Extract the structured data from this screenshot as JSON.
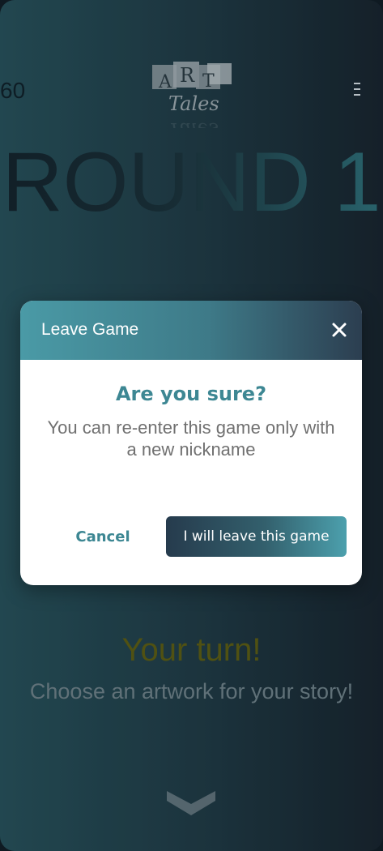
{
  "header": {
    "timer": "60",
    "logo_alt": "ART Tales",
    "logo_letters": [
      "A",
      "R",
      "T"
    ],
    "logo_word": "Tales",
    "menu_icon": "kebab-menu-icon"
  },
  "round": {
    "title": "ROUND 1"
  },
  "prompt": {
    "headline": "Your turn!",
    "subtitle": "Choose an artwork for your story!",
    "scroll_icon": "chevron-down-icon"
  },
  "modal": {
    "title": "Leave Game",
    "close_icon": "close-icon",
    "heading": "Are you sure?",
    "message": "You can re-enter this game only with a new nickname",
    "cancel_label": "Cancel",
    "confirm_label": "I will leave this game"
  },
  "colors": {
    "accent_teal": "#3d8793",
    "header_gradient_start": "#4a9aa6",
    "header_gradient_end": "#2c3e50",
    "headline_olive": "#5a5b12"
  }
}
